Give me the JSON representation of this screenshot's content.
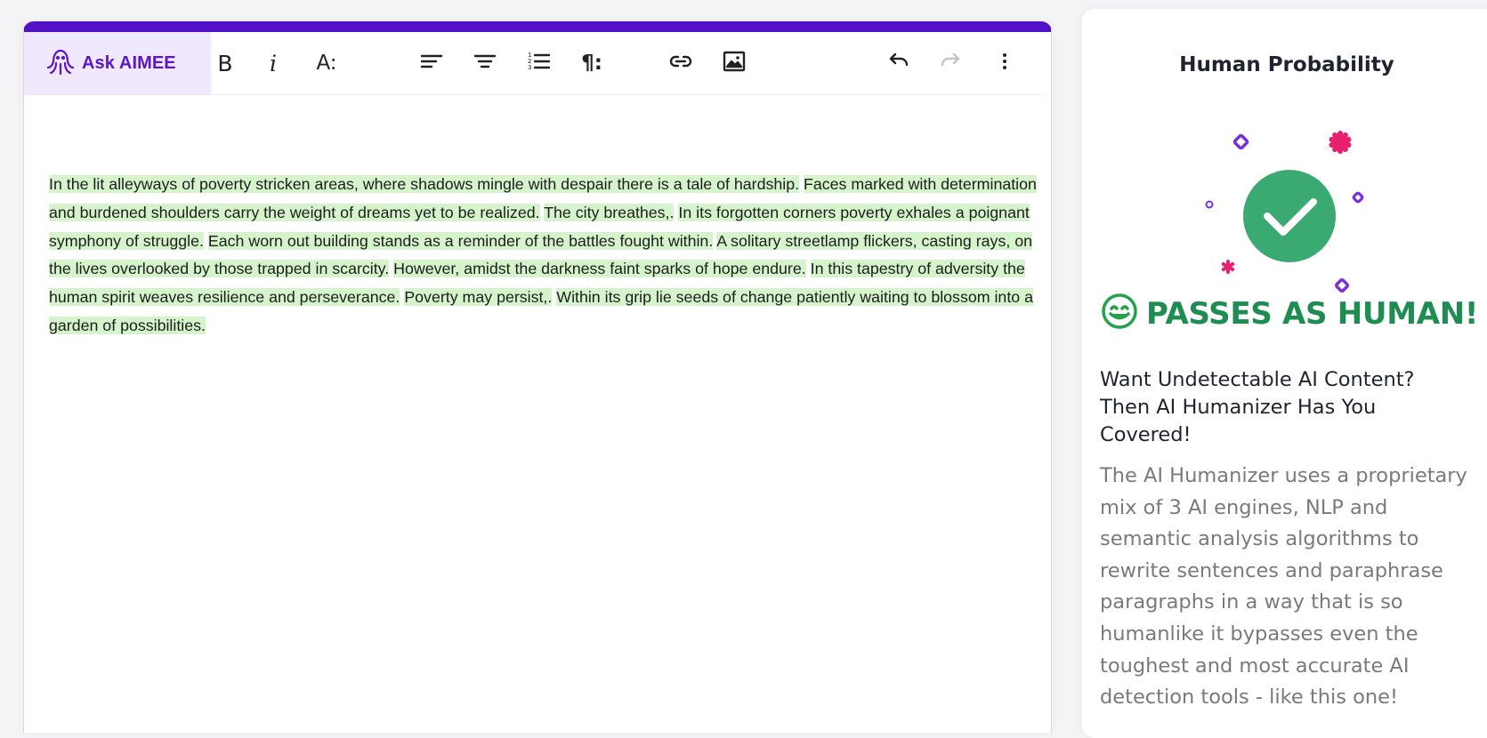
{
  "editor": {
    "accent_color": "#5211c7",
    "ask_button_label": "Ask AIMEE",
    "toolbar": {
      "bold_label": "B",
      "italic_label": "i",
      "font_size_label": "A:",
      "paragraph_label": "¶:",
      "tools": [
        "bold",
        "italic",
        "font-size",
        "align-left",
        "align-center",
        "numbered-list",
        "paragraph",
        "link",
        "image",
        "undo",
        "redo",
        "more"
      ]
    },
    "highlight_color": "#d6f4cc",
    "sentences": [
      "In the lit alleyways of poverty stricken areas, where shadows mingle with despair there is a tale of hardship.",
      "Faces marked with determination and burdened shoulders carry the weight of dreams yet to be realized.",
      "The city breathes,.",
      "In its forgotten corners poverty exhales a poignant symphony of struggle.",
      "Each worn out building stands as a reminder of the battles fought within.",
      "A solitary streetlamp flickers, casting rays, on the lives overlooked by those trapped in scarcity.",
      "However, amidst the darkness faint sparks of hope endure.",
      "In this tapestry of adversity the human spirit weaves resilience and perseverance.",
      "Poverty may persist,.",
      "Within its grip lie seeds of change patiently waiting to blossom into a garden of possibilities."
    ]
  },
  "sidebar": {
    "title": "Human Probability",
    "verdict": "PASSES AS HUMAN!",
    "verdict_color": "#1f8c52",
    "check_color": "#3aaa72",
    "promo_title": "Want Undetectable AI Content? Then AI Humanizer Has You Covered!",
    "promo_body": "The AI Humanizer uses a proprietary mix of 3 AI engines, NLP and semantic analysis algorithms to rewrite sentences and paraphrase paragraphs in a way that is so humanlike it bypasses even the toughest and most accurate AI detection tools - like this one!"
  }
}
